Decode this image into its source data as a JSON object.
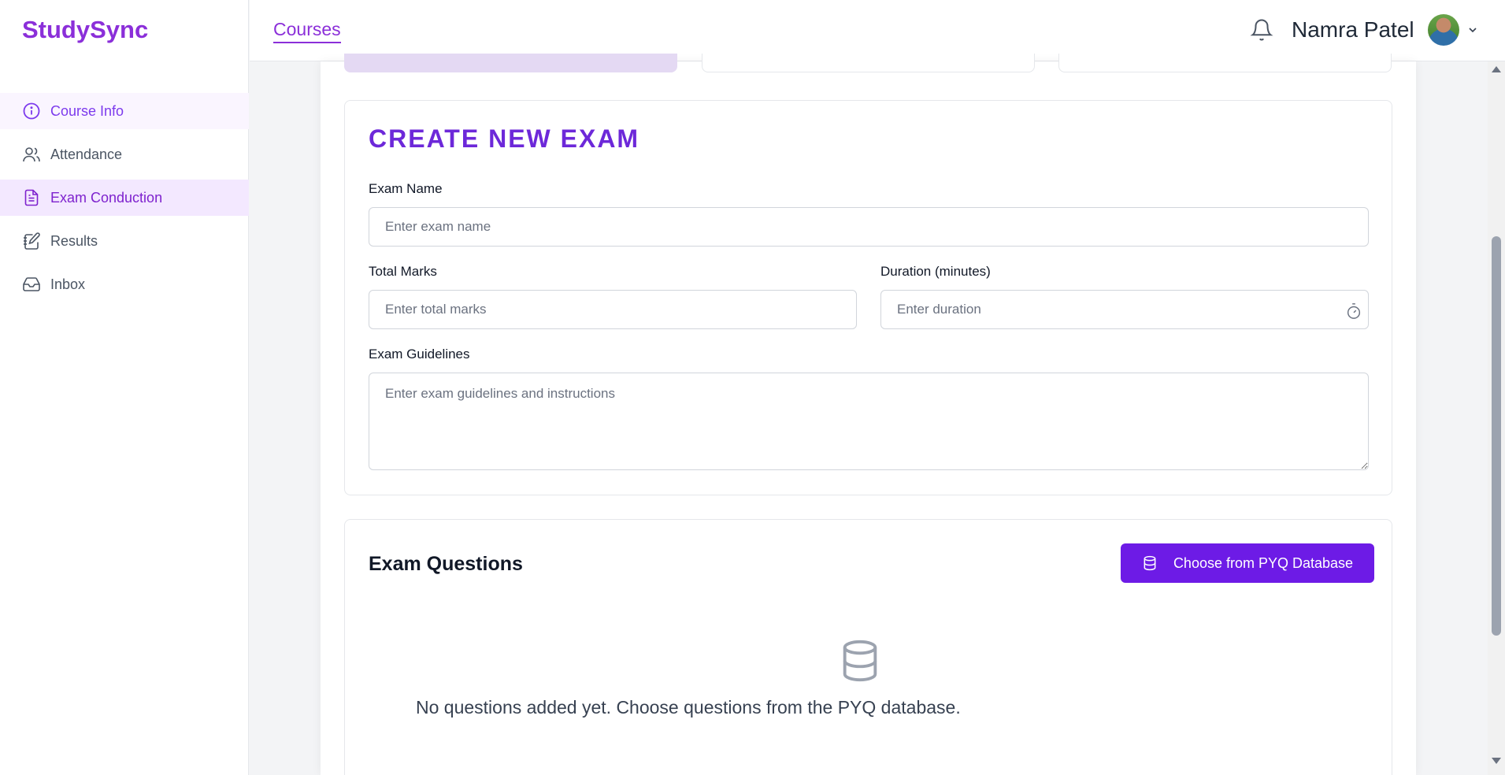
{
  "app": {
    "logo": "StudySync"
  },
  "sidebar": {
    "items": [
      {
        "label": "Course Info",
        "icon": "info-icon"
      },
      {
        "label": "Attendance",
        "icon": "users-icon"
      },
      {
        "label": "Exam Conduction",
        "icon": "document-icon"
      },
      {
        "label": "Results",
        "icon": "notebook-pen-icon"
      },
      {
        "label": "Inbox",
        "icon": "inbox-icon"
      }
    ]
  },
  "header": {
    "tab": "Courses",
    "user_name": "Namra Patel"
  },
  "exam_form": {
    "title": "CREATE NEW EXAM",
    "exam_name_label": "Exam Name",
    "exam_name_placeholder": "Enter exam name",
    "total_marks_label": "Total Marks",
    "total_marks_placeholder": "Enter total marks",
    "duration_label": "Duration (minutes)",
    "duration_placeholder": "Enter duration",
    "guidelines_label": "Exam Guidelines",
    "guidelines_placeholder": "Enter exam guidelines and instructions"
  },
  "questions": {
    "title": "Exam Questions",
    "pyq_button": "Choose from PYQ Database",
    "empty_text": "No questions added yet. Choose questions from the PYQ database."
  },
  "colors": {
    "brand": "#8b2fd9",
    "primary_button": "#6d1be6",
    "active_nav_bg": "#f3e8ff"
  }
}
